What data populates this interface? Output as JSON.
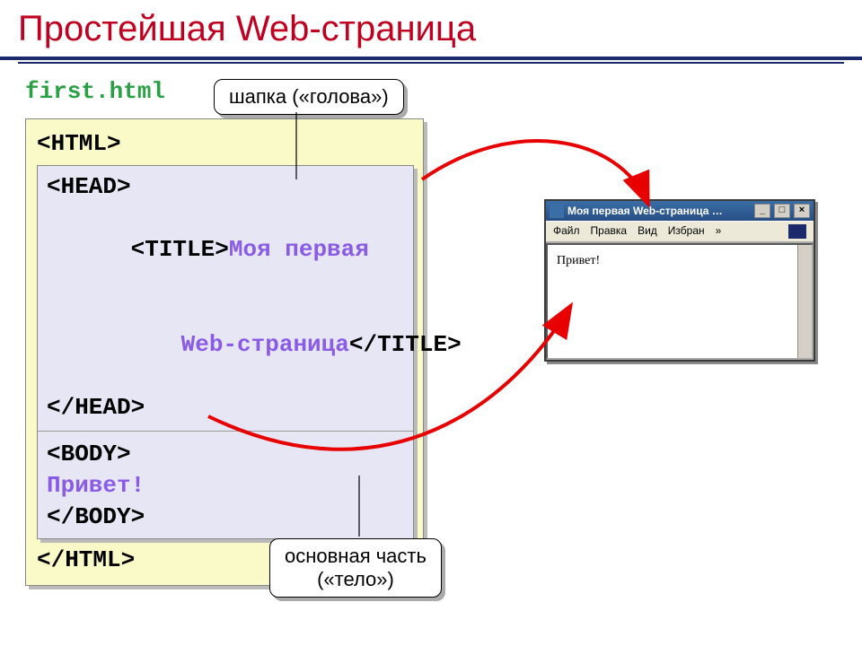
{
  "title": "Простейшая Web-страница",
  "filename": "first.html",
  "code": {
    "html_open": "<HTML>",
    "head_open": "<HEAD>",
    "title_open": "<TITLE>",
    "title_text_l1": "Моя первая",
    "title_text_l2": "Web-страница",
    "title_close": "</TITLE>",
    "head_close": "</HEAD>",
    "body_open": "<BODY>",
    "body_text": "Привет!",
    "body_close": "</BODY>",
    "html_close": "</HTML>"
  },
  "callout_top": "шапка («голова»)",
  "callout_bot_l1": "основная часть",
  "callout_bot_l2": "(«тело»)",
  "browser": {
    "title": "Моя первая Web-страница …",
    "menus": [
      "Файл",
      "Правка",
      "Вид",
      "Избран"
    ],
    "menu_more": "»",
    "page_text": "Привет!"
  }
}
